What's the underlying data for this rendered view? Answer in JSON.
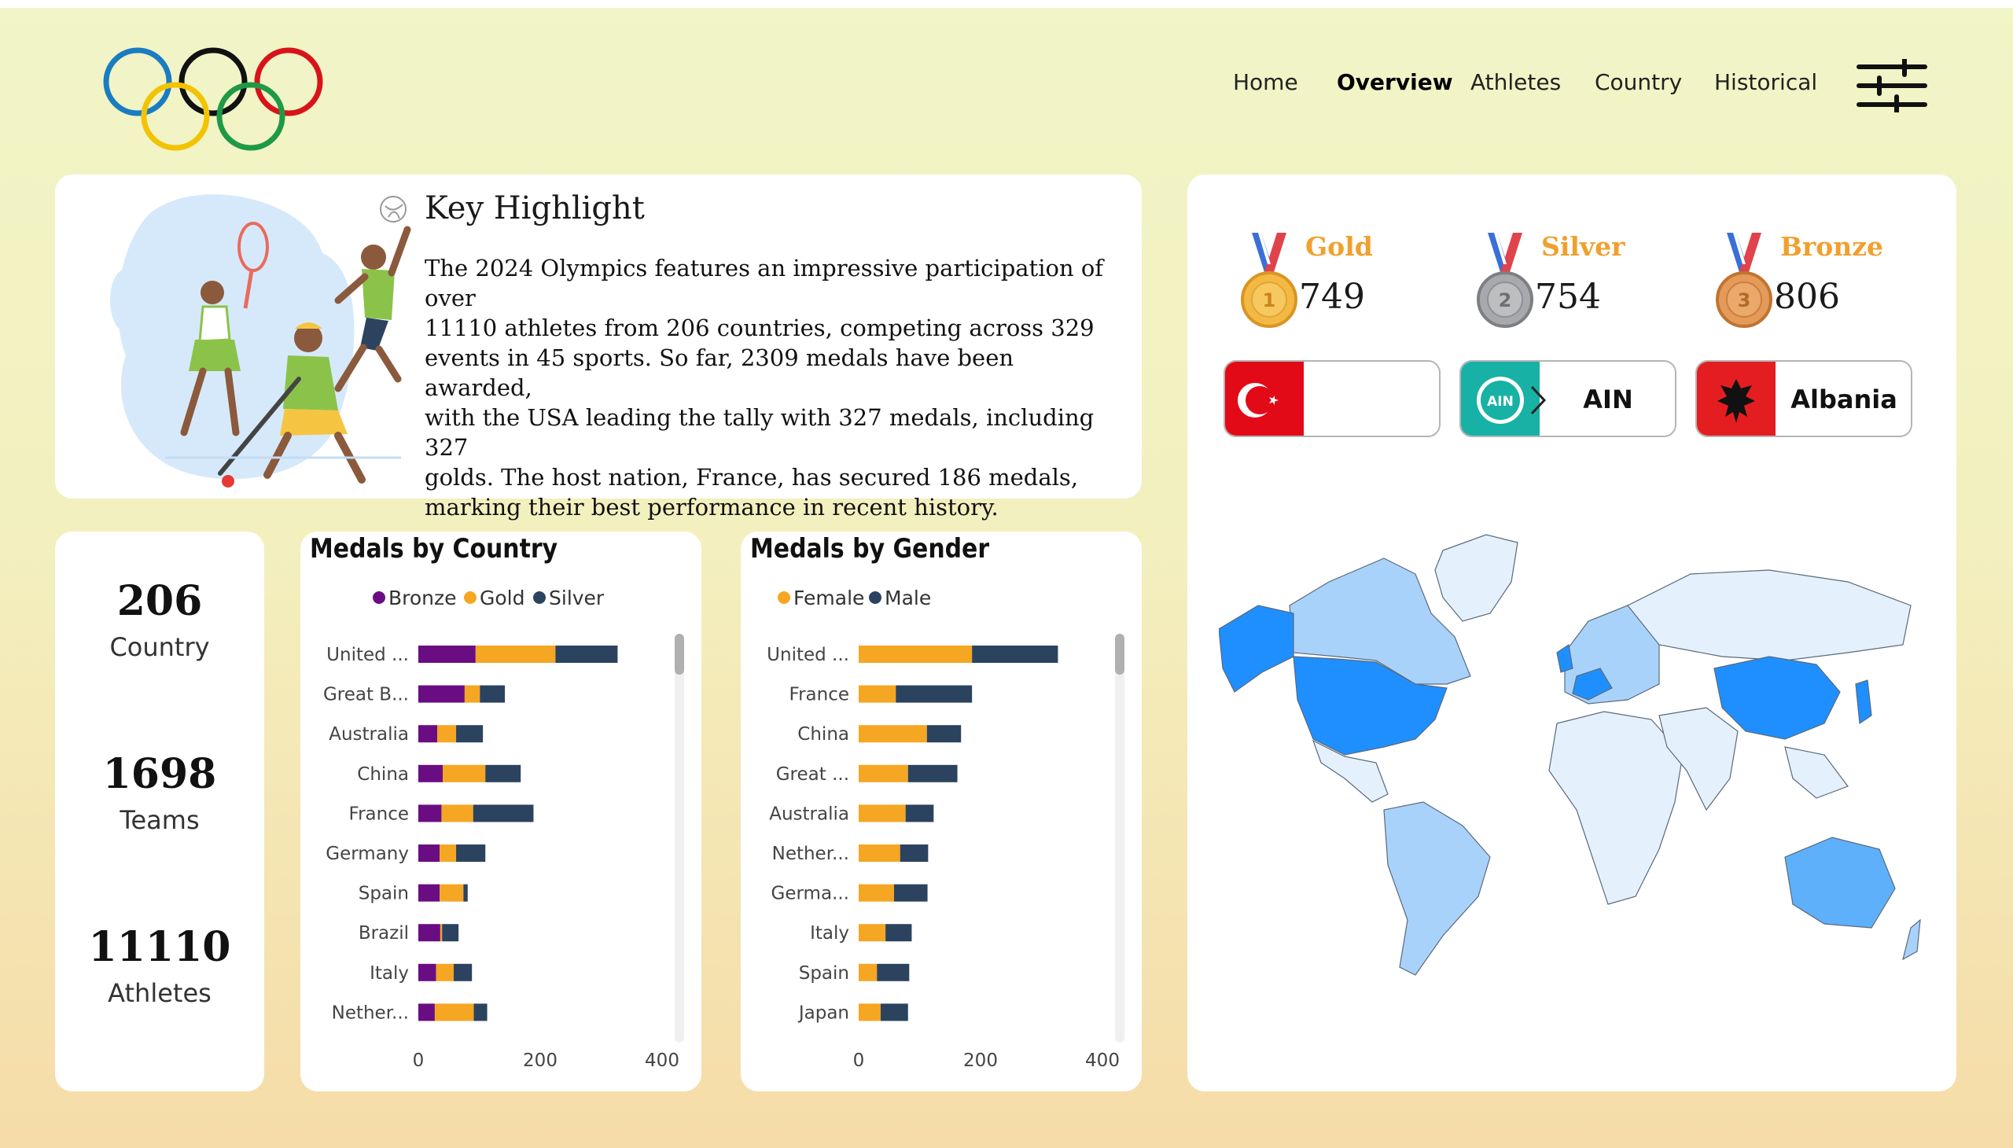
{
  "nav": {
    "items": [
      "Home",
      "Overview",
      "Athletes",
      "Country",
      "Historical"
    ],
    "active": "Overview"
  },
  "key_highlight": {
    "title": "Key Highlight",
    "lines": [
      "The 2024 Olympics features an impressive participation of over",
      "11110 athletes from 206 countries, competing across 329",
      "events in 45 sports. So far, 2309 medals have been awarded,",
      "with the USA leading the tally with 327 medals, including 327",
      "golds. The host nation, France, has secured 186 medals,",
      "marking their best performance in recent history."
    ]
  },
  "stats": {
    "country_value": "206",
    "country_label": "Country",
    "teams_value": "1698",
    "teams_label": "Teams",
    "athletes_value": "11110",
    "athletes_label": "Athletes"
  },
  "medals": {
    "gold_label": "Gold",
    "gold_value": "749",
    "silver_label": "Silver",
    "silver_value": "754",
    "bronze_label": "Bronze",
    "bronze_value": "806"
  },
  "flags": [
    {
      "label": "",
      "icon": "turkey-flag-icon"
    },
    {
      "label": "AIN",
      "icon": "ain-emblem-icon"
    },
    {
      "label": "Albania",
      "icon": "albania-flag-icon"
    }
  ],
  "colors": {
    "bronze": "#6a0d83",
    "gold": "#f5a623",
    "silver": "#2b435f",
    "female": "#f5a623",
    "male": "#2b435f",
    "medal_title": "#f0a02c",
    "map_high": "#1f8fff",
    "map_mid": "#a9d2fb",
    "map_low": "#e4f0fc"
  },
  "chart_data": [
    {
      "type": "bar",
      "orientation": "horizontal",
      "stacked": true,
      "title": "Medals by Country",
      "legend_position": "top",
      "categories": [
        "United ...",
        "Great B...",
        "Australia",
        "China",
        "France",
        "Germany",
        "Spain",
        "Brazil",
        "Italy",
        "Nether..."
      ],
      "series": [
        {
          "name": "Bronze",
          "values": [
            94,
            76,
            31,
            40,
            38,
            35,
            35,
            36,
            29,
            27
          ]
        },
        {
          "name": "Gold",
          "values": [
            131,
            25,
            31,
            70,
            52,
            27,
            39,
            3,
            29,
            64
          ]
        },
        {
          "name": "Silver",
          "values": [
            102,
            41,
            44,
            58,
            99,
            48,
            7,
            27,
            30,
            22
          ]
        }
      ],
      "xticks": [
        0,
        200,
        400
      ],
      "xlim": [
        0,
        400
      ]
    },
    {
      "type": "bar",
      "orientation": "horizontal",
      "stacked": true,
      "title": "Medals by Gender",
      "legend_position": "top",
      "categories": [
        "United ...",
        "France",
        "China",
        "Great ...",
        "Australia",
        "Nether...",
        "Germa...",
        "Italy",
        "Spain",
        "Japan"
      ],
      "series": [
        {
          "name": "Female",
          "values": [
            186,
            61,
            112,
            81,
            77,
            68,
            58,
            44,
            30,
            36
          ]
        },
        {
          "name": "Male",
          "values": [
            141,
            125,
            56,
            81,
            46,
            46,
            55,
            43,
            53,
            45
          ]
        }
      ],
      "xticks": [
        0,
        200,
        400
      ],
      "xlim": [
        0,
        400
      ]
    }
  ]
}
